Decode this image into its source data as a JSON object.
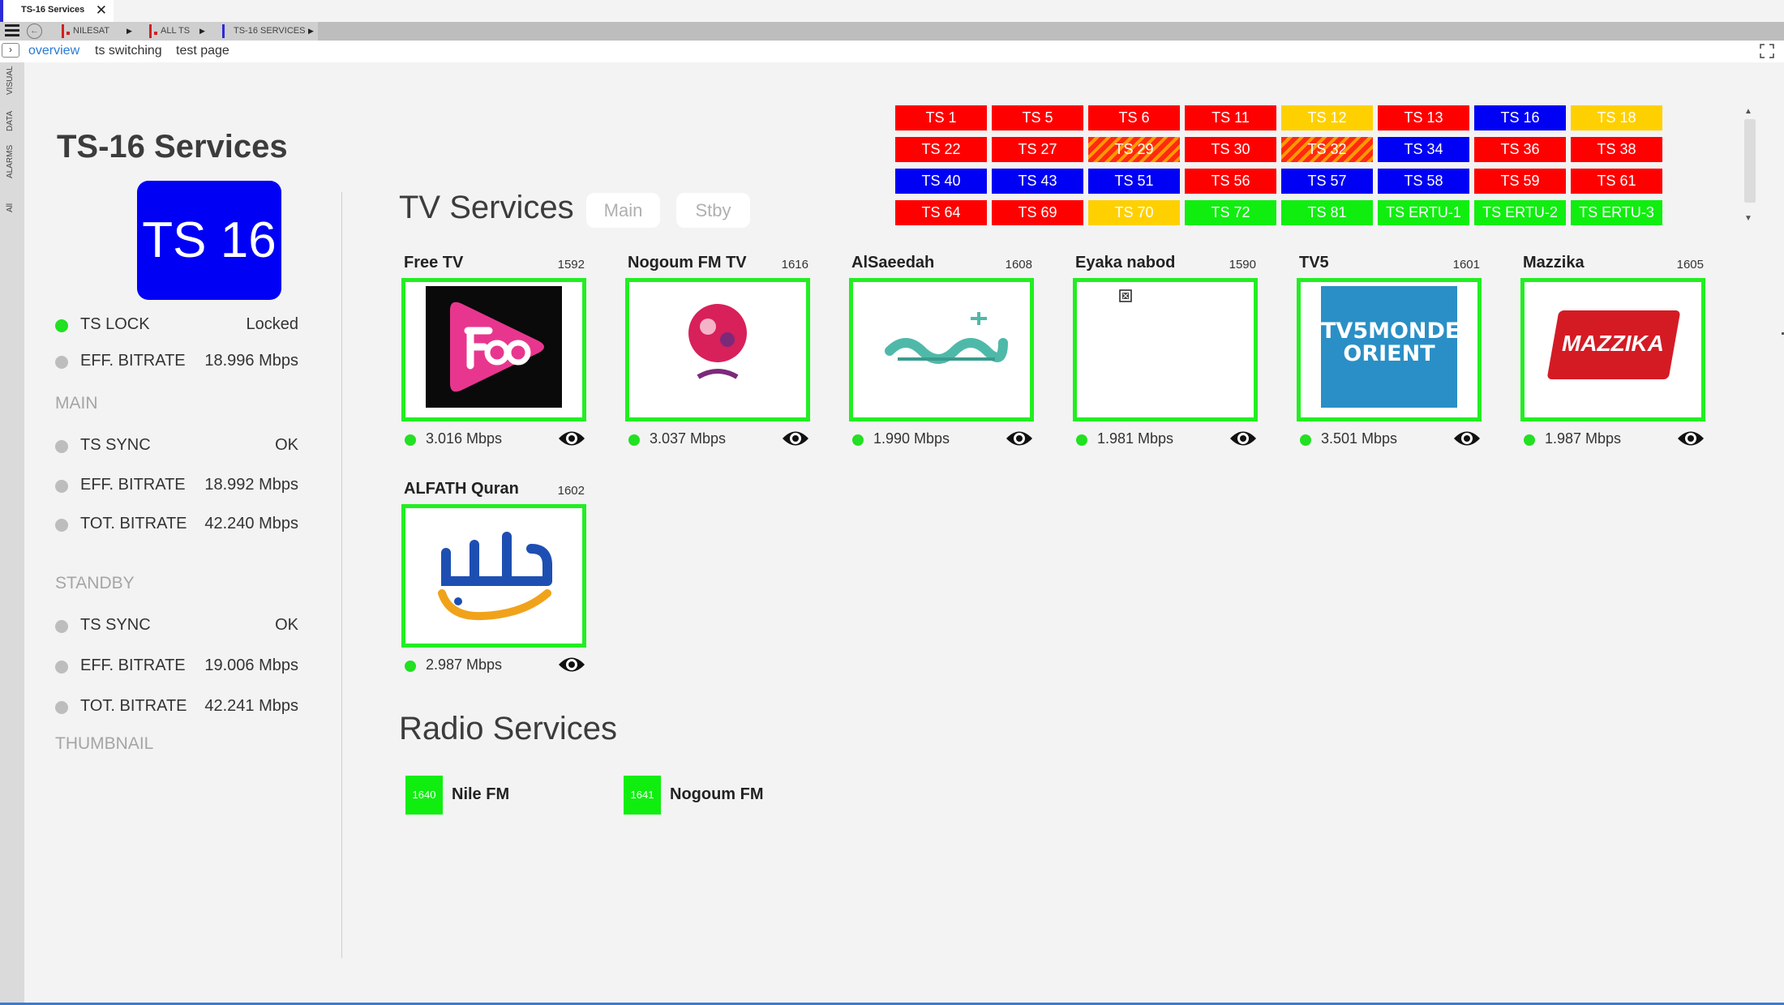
{
  "window": {
    "tab_title": "TS-16 Services",
    "close_glyph": "✕"
  },
  "breadcrumb": [
    {
      "label": "NILESAT"
    },
    {
      "label": "ALL TS"
    },
    {
      "label": "TS-16 SERVICES"
    }
  ],
  "subtabs": [
    "overview",
    "ts switching",
    "test page"
  ],
  "rail": [
    "VISUAL",
    "DATA",
    "ALARMS",
    "All"
  ],
  "page": {
    "title": "TS-16 Services",
    "badge": "TS 16"
  },
  "status": {
    "ts_lock": {
      "label": "TS LOCK",
      "value": "Locked"
    },
    "eff_bitrate": {
      "label": "EFF. BITRATE",
      "value": "18.996 Mbps"
    },
    "main": {
      "heading": "MAIN",
      "ts_sync": {
        "label": "TS SYNC",
        "value": "OK"
      },
      "eff_bitrate": {
        "label": "EFF. BITRATE",
        "value": "18.992 Mbps"
      },
      "tot_bitrate": {
        "label": "TOT. BITRATE",
        "value": "42.240 Mbps"
      }
    },
    "standby": {
      "heading": "STANDBY",
      "ts_sync": {
        "label": "TS SYNC",
        "value": "OK"
      },
      "eff_bitrate": {
        "label": "EFF. BITRATE",
        "value": "19.006 Mbps"
      },
      "tot_bitrate": {
        "label": "TOT. BITRATE",
        "value": "42.241 Mbps"
      }
    },
    "thumbnail_heading": "THUMBNAIL"
  },
  "tv_services": {
    "heading": "TV Services",
    "stream_buttons": [
      "Main",
      "Stby"
    ],
    "items": [
      {
        "name": "Free TV",
        "id": "1592",
        "bitrate": "3.016 Mbps",
        "logo": "free-tv-logo"
      },
      {
        "name": "Nogoum FM TV",
        "id": "1616",
        "bitrate": "3.037 Mbps",
        "logo": "nogoum-logo"
      },
      {
        "name": "AlSaeedah",
        "id": "1608",
        "bitrate": "1.990 Mbps",
        "logo": "alsaeedah-logo"
      },
      {
        "name": "Eyaka nabod",
        "id": "1590",
        "bitrate": "1.981 Mbps",
        "logo": "broken-image-icon"
      },
      {
        "name": "TV5",
        "id": "1601",
        "bitrate": "3.501 Mbps",
        "logo": "tv5monde-logo",
        "logo_text": [
          "TV5MONDE",
          "ORIENT"
        ]
      },
      {
        "name": "Mazzika",
        "id": "1605",
        "bitrate": "1.987 Mbps",
        "logo": "mazzika-logo",
        "logo_text": "MAZZIKA"
      },
      {
        "name": "ALFATH Quran",
        "id": "1602",
        "bitrate": "2.987 Mbps",
        "logo": "alfath-logo"
      }
    ]
  },
  "radio_services": {
    "heading": "Radio Services",
    "items": [
      {
        "id": "1640",
        "name": "Nile FM"
      },
      {
        "id": "1641",
        "name": "Nogoum FM"
      }
    ]
  },
  "ts_grid": [
    {
      "label": "TS 1",
      "status": "red"
    },
    {
      "label": "TS 5",
      "status": "red"
    },
    {
      "label": "TS 6",
      "status": "red"
    },
    {
      "label": "TS 11",
      "status": "red"
    },
    {
      "label": "TS 12",
      "status": "yellow"
    },
    {
      "label": "TS 13",
      "status": "red"
    },
    {
      "label": "TS 16",
      "status": "blue"
    },
    {
      "label": "TS 18",
      "status": "yellow"
    },
    {
      "label": "TS 22",
      "status": "red"
    },
    {
      "label": "TS 27",
      "status": "red"
    },
    {
      "label": "TS 29",
      "status": "striped"
    },
    {
      "label": "TS 30",
      "status": "red"
    },
    {
      "label": "TS 32",
      "status": "striped"
    },
    {
      "label": "TS 34",
      "status": "blue"
    },
    {
      "label": "TS 36",
      "status": "red"
    },
    {
      "label": "TS 38",
      "status": "red"
    },
    {
      "label": "TS 40",
      "status": "blue"
    },
    {
      "label": "TS 43",
      "status": "blue"
    },
    {
      "label": "TS 51",
      "status": "blue"
    },
    {
      "label": "TS 56",
      "status": "red"
    },
    {
      "label": "TS 57",
      "status": "blue"
    },
    {
      "label": "TS 58",
      "status": "blue"
    },
    {
      "label": "TS 59",
      "status": "red"
    },
    {
      "label": "TS 61",
      "status": "red"
    },
    {
      "label": "TS 64",
      "status": "red"
    },
    {
      "label": "TS 69",
      "status": "red"
    },
    {
      "label": "TS 70",
      "status": "yellow"
    },
    {
      "label": "TS 72",
      "status": "green"
    },
    {
      "label": "TS 81",
      "status": "green"
    },
    {
      "label": "TS ERTU-1",
      "status": "green"
    },
    {
      "label": "TS ERTU-2",
      "status": "green"
    },
    {
      "label": "TS ERTU-3",
      "status": "green"
    }
  ],
  "colors": {
    "ok": "#22e022",
    "alarm": "#ff0000",
    "selected": "#0000f4",
    "warning": "#ffd000",
    "accent": "#2a7ad5"
  }
}
